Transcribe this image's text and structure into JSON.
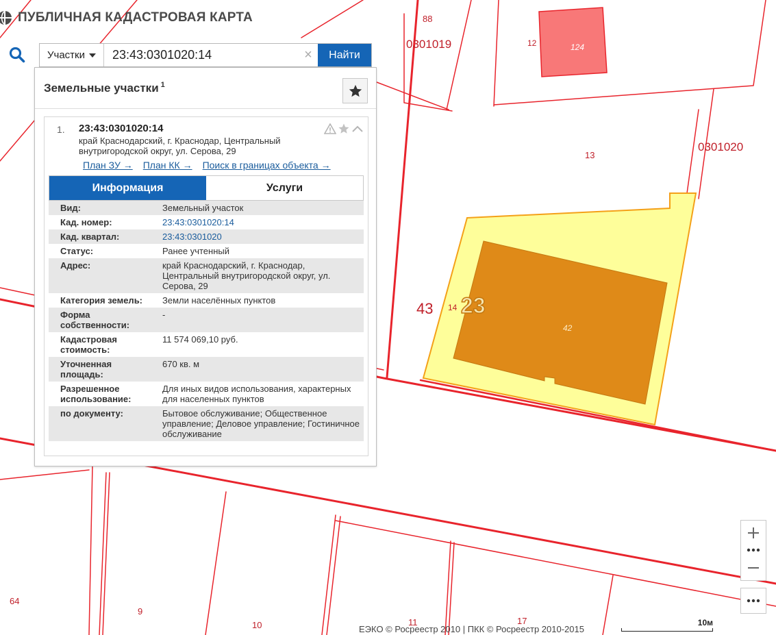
{
  "header": {
    "title": "ПУБЛИЧНАЯ КАДАСТРОВАЯ КАРТА",
    "logo_icon": "globe-logo-icon"
  },
  "search": {
    "type_label": "Участки",
    "query": "23:43:0301020:14",
    "submit_label": "Найти",
    "clear_glyph": "×"
  },
  "panel": {
    "title": "Земельные участки",
    "count": "1",
    "result": {
      "index": "1.",
      "cad_number": "23:43:0301020:14",
      "address": "край Краснодарский, г. Краснодар, Центральный внутригородской округ, ул. Серова, 29",
      "links": [
        "План ЗУ →",
        "План КК →",
        "Поиск в границах объекта →"
      ],
      "tabs": [
        {
          "label": "Информация",
          "active": true
        },
        {
          "label": "Услуги",
          "active": false
        }
      ],
      "info": [
        {
          "key": "Вид:",
          "value": "Земельный участок"
        },
        {
          "key": "Кад. номер:",
          "value": "23:43:0301020:14",
          "link": true
        },
        {
          "key": "Кад. квартал:",
          "value": "23:43:0301020",
          "link": true
        },
        {
          "key": "Статус:",
          "value": "Ранее учтенный"
        },
        {
          "key": "Адрес:",
          "value": "край Краснодарский, г. Краснодар, Центральный внутригородской округ, ул. Серова, 29"
        },
        {
          "key": "Категория земель:",
          "value": "Земли населённых пунктов"
        },
        {
          "key": "Форма собственности:",
          "value": "-"
        },
        {
          "key": "Кадастровая стоимость:",
          "value": "11 574 069,10 руб."
        },
        {
          "key": "Уточненная площадь:",
          "value": "670 кв. м"
        },
        {
          "key": "Разрешенное использование:",
          "value": "Для иных видов использования, характерных для населенных пунктов"
        },
        {
          "key": "по документу:",
          "value": "Бытовое обслуживание; Общественное управление; Деловое управление; Гостиничное обслуживание"
        }
      ]
    }
  },
  "map": {
    "labels": {
      "n88": "88",
      "q0301019": "0301019",
      "n12": "12",
      "n124": "124",
      "q0301020": "0301020",
      "n13": "13",
      "n43": "43",
      "n14": "14",
      "n23": "23",
      "n42": "42",
      "n64": "64",
      "n9": "9",
      "n10": "10",
      "n11": "11",
      "n17": "17"
    },
    "colors": {
      "boundary": "#e8242c",
      "selected_fill": "#fefe9a",
      "selected_stroke": "#f4a018",
      "building_fill": "#df8a18",
      "neighbor_fill": "#f87878",
      "accent": "#1565b6"
    }
  },
  "controls": {
    "zoom_in": "+",
    "zoom_out": "−",
    "dots": "•••",
    "more": "•••"
  },
  "footer": {
    "attribution": "ЕЭКО © Росреестр 2010 | ПКК © Росреестр 2010-2015",
    "scale": "10м"
  }
}
